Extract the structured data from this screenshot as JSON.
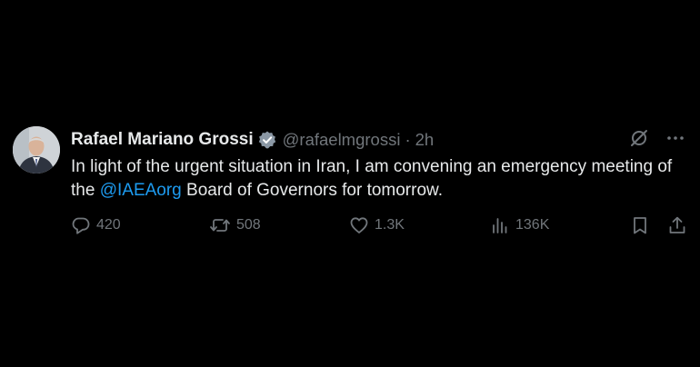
{
  "tweet": {
    "display_name": "Rafael Mariano Grossi",
    "handle": "@rafaelmgrossi",
    "separator": "·",
    "time": "2h",
    "text_part1": "In light of the urgent situation in Iran, I am convening an emergency meeting of the ",
    "mention": "@IAEAorg",
    "text_part2": " Board of Governors for tomorrow."
  },
  "actions": {
    "replies": "420",
    "reposts": "508",
    "likes": "1.3K",
    "views": "136K"
  },
  "icons": [
    "verified-badge-icon",
    "grok-icon",
    "more-icon",
    "reply-icon",
    "repost-icon",
    "like-icon",
    "views-icon",
    "bookmark-icon",
    "share-icon"
  ],
  "colors": {
    "background": "#000000",
    "text": "#e7e9ea",
    "secondary": "#71767b",
    "accent": "#1d9bf0"
  }
}
